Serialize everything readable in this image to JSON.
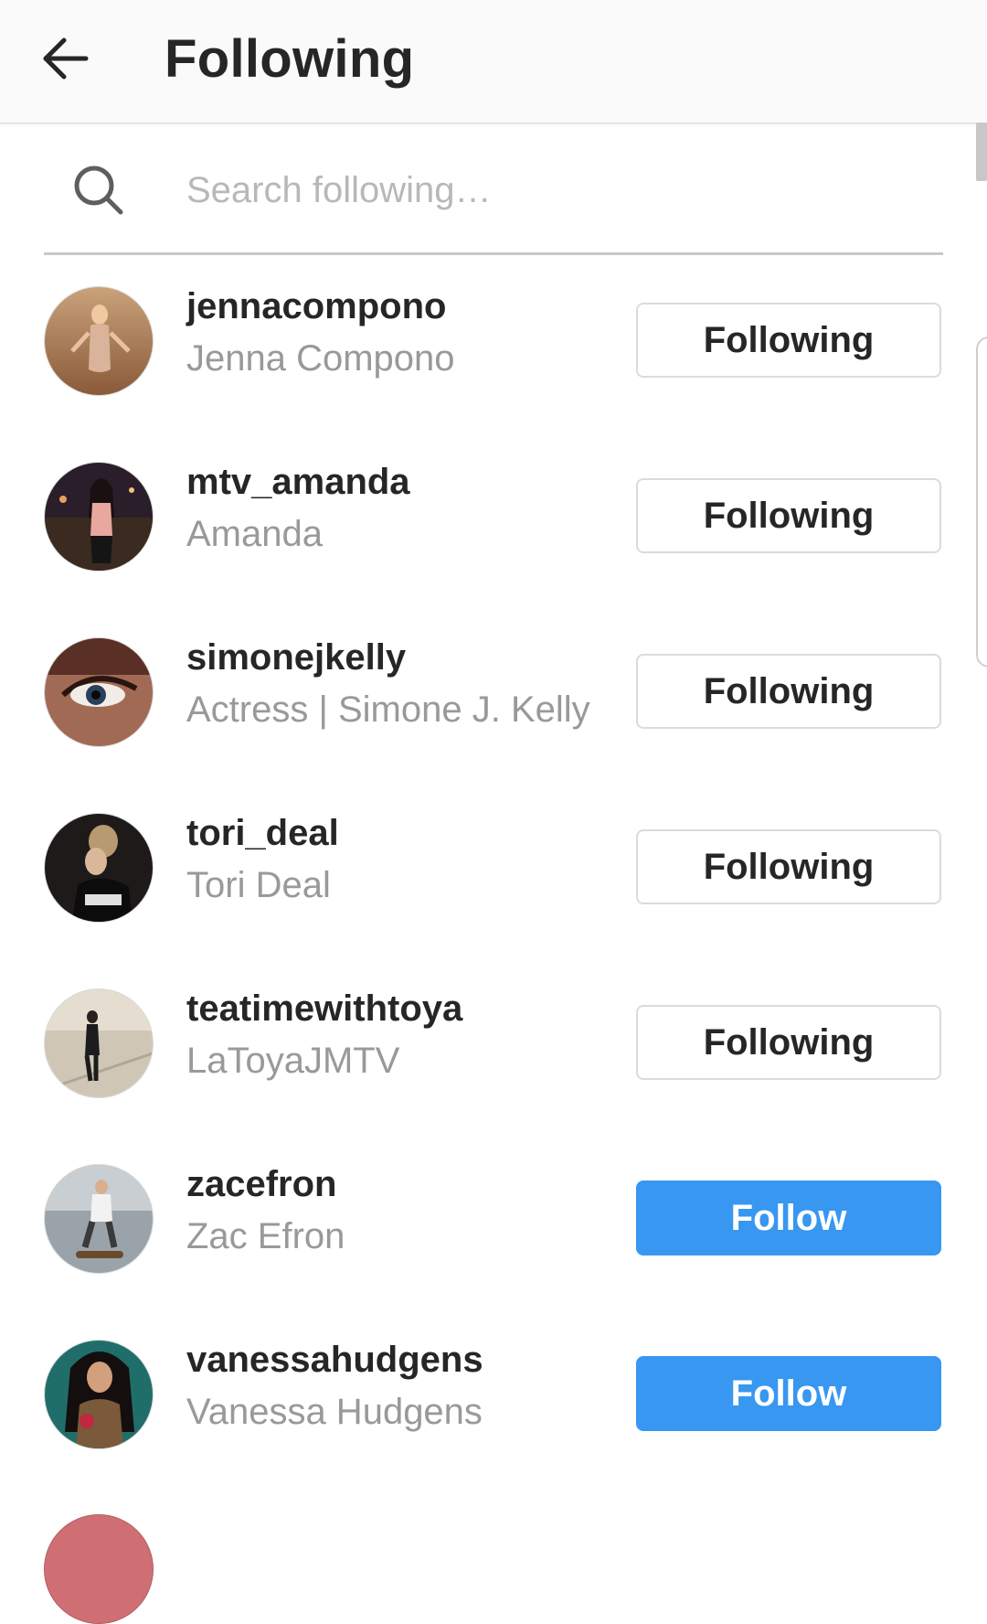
{
  "header": {
    "title": "Following",
    "back_icon": "arrow-left-icon"
  },
  "search": {
    "placeholder": "Search following…",
    "value": "",
    "icon": "search-icon"
  },
  "colors": {
    "follow_blue": "#3897f0",
    "primary_text": "#262626",
    "secondary_text": "#999999",
    "border": "#dbdbdb"
  },
  "accounts": [
    {
      "username": "jennacompono",
      "full_name": "Jenna Compono",
      "button": "Following"
    },
    {
      "username": "mtv_amanda",
      "full_name": "Amanda",
      "button": "Following"
    },
    {
      "username": "simonejkelly",
      "full_name": "Actress | Simone J. Kelly",
      "button": "Following"
    },
    {
      "username": "tori_deal",
      "full_name": "Tori Deal",
      "button": "Following"
    },
    {
      "username": "teatimewithtoya",
      "full_name": "LaToyaJMTV",
      "button": "Following"
    },
    {
      "username": "zacefron",
      "full_name": "Zac Efron",
      "button": "Follow"
    },
    {
      "username": "vanessahudgens",
      "full_name": "Vanessa Hudgens",
      "button": "Follow"
    }
  ]
}
